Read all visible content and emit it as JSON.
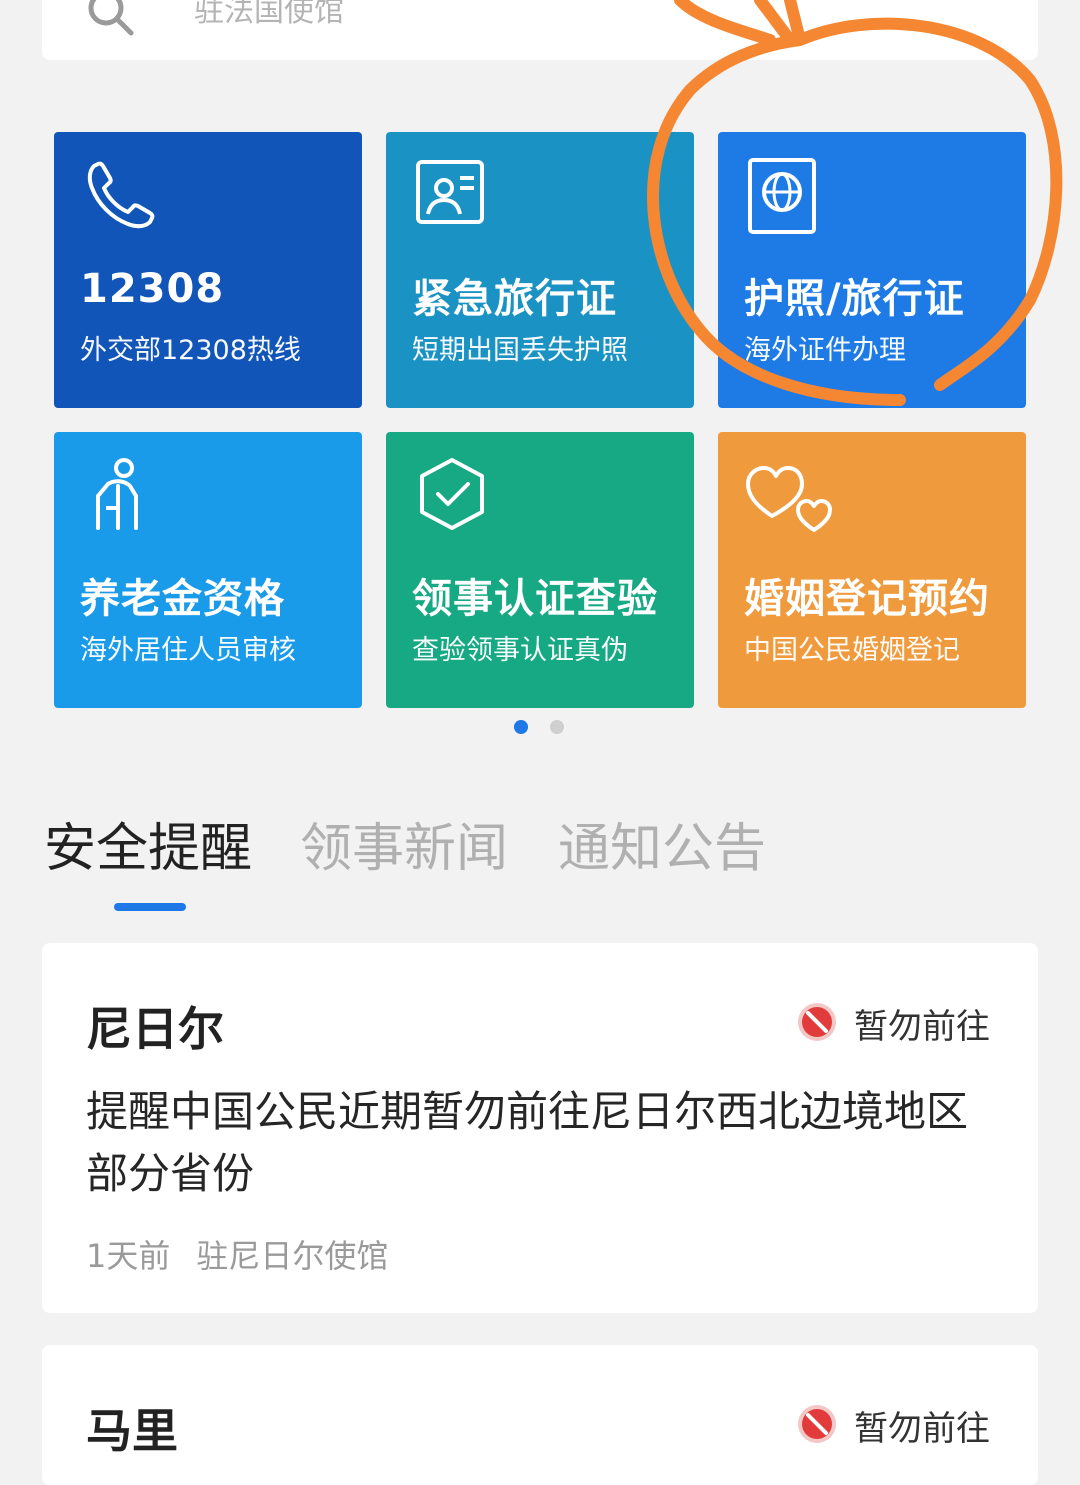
{
  "search": {
    "placeholder": "驻法国使馆"
  },
  "services": [
    {
      "id": "hotline",
      "title": "12308",
      "subtitle": "外交部12308热线",
      "icon": "phone-icon",
      "color": "#1255b8"
    },
    {
      "id": "emergency-travel-doc",
      "title": "紧急旅行证",
      "subtitle": "短期出国丢失护照",
      "icon": "id-card-icon",
      "color": "#1a92c4"
    },
    {
      "id": "passport",
      "title": "护照/旅行证",
      "subtitle": "海外证件办理",
      "icon": "passport-globe-icon",
      "color": "#1e7be6"
    },
    {
      "id": "pension",
      "title": "养老金资格",
      "subtitle": "海外居住人员审核",
      "icon": "elderly-person-icon",
      "color": "#1a9bea"
    },
    {
      "id": "consular-cert",
      "title": "领事认证查验",
      "subtitle": "查验领事认证真伪",
      "icon": "shield-check-icon",
      "color": "#17a884"
    },
    {
      "id": "marriage",
      "title": "婚姻登记预约",
      "subtitle": "中国公民婚姻登记",
      "icon": "hearts-icon",
      "color": "#ef9a3c"
    }
  ],
  "pager": {
    "active": 0,
    "count": 2,
    "active_color": "#1e78e6",
    "inactive_color": "#cfcfcf"
  },
  "tabs": [
    {
      "label": "安全提醒",
      "active": true
    },
    {
      "label": "领事新闻",
      "active": false
    },
    {
      "label": "通知公告",
      "active": false
    }
  ],
  "alerts": [
    {
      "country": "尼日尔",
      "level": "暂勿前往",
      "level_icon": "no-entry-icon",
      "headline": "提醒中国公民近期暂勿前往尼日尔西北边境地区部分省份",
      "time": "1天前",
      "source": "驻尼日尔使馆"
    },
    {
      "country": "马里",
      "level": "暂勿前往",
      "level_icon": "no-entry-icon"
    }
  ],
  "colors": {
    "accent": "#1e78e6",
    "annotation": "#f58733",
    "danger": "#e23b3b"
  }
}
